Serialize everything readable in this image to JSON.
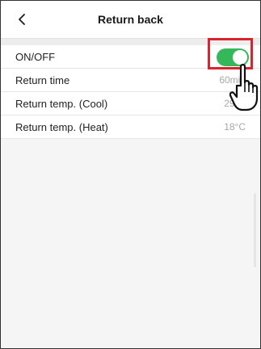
{
  "header": {
    "title": "Return back",
    "back_icon": "chevron-left-icon"
  },
  "settings": [
    {
      "label": "ON/OFF",
      "type": "toggle",
      "on": true
    },
    {
      "label": "Return time",
      "value": "60min"
    },
    {
      "label": "Return temp.  (Cool)",
      "value": "29°C"
    },
    {
      "label": "Return temp.  (Heat)",
      "value": "18°C"
    }
  ],
  "colors": {
    "toggle_on": "#34b85a",
    "highlight": "#d9232d",
    "value_text": "#a8a8a8"
  },
  "overlay": {
    "pointer_icon": "hand-pointer-icon"
  }
}
